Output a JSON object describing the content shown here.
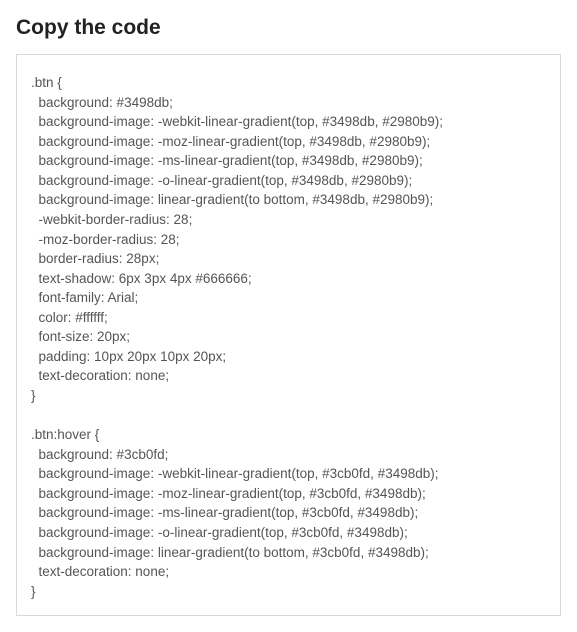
{
  "heading": "Copy the code",
  "code": ".btn {\n  background: #3498db;\n  background-image: -webkit-linear-gradient(top, #3498db, #2980b9);\n  background-image: -moz-linear-gradient(top, #3498db, #2980b9);\n  background-image: -ms-linear-gradient(top, #3498db, #2980b9);\n  background-image: -o-linear-gradient(top, #3498db, #2980b9);\n  background-image: linear-gradient(to bottom, #3498db, #2980b9);\n  -webkit-border-radius: 28;\n  -moz-border-radius: 28;\n  border-radius: 28px;\n  text-shadow: 6px 3px 4px #666666;\n  font-family: Arial;\n  color: #ffffff;\n  font-size: 20px;\n  padding: 10px 20px 10px 20px;\n  text-decoration: none;\n}\n\n.btn:hover {\n  background: #3cb0fd;\n  background-image: -webkit-linear-gradient(top, #3cb0fd, #3498db);\n  background-image: -moz-linear-gradient(top, #3cb0fd, #3498db);\n  background-image: -ms-linear-gradient(top, #3cb0fd, #3498db);\n  background-image: -o-linear-gradient(top, #3cb0fd, #3498db);\n  background-image: linear-gradient(to bottom, #3cb0fd, #3498db);\n  text-decoration: none;\n}"
}
